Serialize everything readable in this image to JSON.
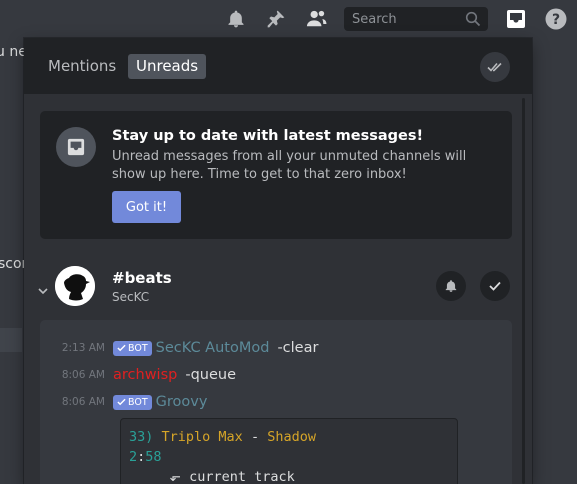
{
  "background": {
    "fragments": [
      "u new",
      "scor"
    ]
  },
  "topbar": {
    "search_placeholder": "Search",
    "icons": [
      "bell-icon",
      "pin-icon",
      "members-icon",
      "search-icon",
      "inbox-icon",
      "help-icon"
    ]
  },
  "inbox": {
    "tabs": [
      {
        "label": "Mentions",
        "active": false
      },
      {
        "label": "Unreads",
        "active": true
      }
    ],
    "promo": {
      "title": "Stay up to date with latest messages!",
      "description": "Unread messages from all your unmuted channels will show up here. Time to get to that zero inbox!",
      "button": "Got it!"
    },
    "channel": {
      "name": "#beats",
      "guild": "SecKC"
    },
    "messages": [
      {
        "time": "2:13 AM",
        "bot": "BOT",
        "author": "SecKC AutoMod",
        "author_color": "#5c8a99",
        "content": "-clear"
      },
      {
        "time": "8:06 AM",
        "bot": "",
        "author": "archwisp",
        "author_color": "#e02020",
        "content": "-queue"
      },
      {
        "time": "8:06 AM",
        "bot": "BOT",
        "author": "Groovy",
        "author_color": "#5c8a99",
        "content": ""
      }
    ],
    "code": {
      "num": "33)",
      "title": "Triplo Max",
      "sep": "-",
      "track": "Shadow",
      "dur_min": "2",
      "dur_sep": ":",
      "dur_sec": "58",
      "arrow": "⬐",
      "current": "current track"
    }
  },
  "colors": {
    "accent": "#7289da",
    "code_number": "#2aa198",
    "code_title": "#d6a528",
    "code_track": "#d6a528"
  }
}
